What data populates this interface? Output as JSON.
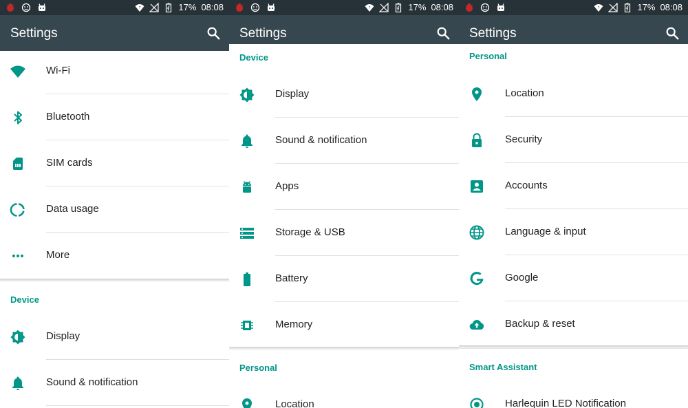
{
  "colors": {
    "accent": "#009688",
    "toolbar": "#37474f",
    "statusbar": "#263238",
    "text": "#212121"
  },
  "status": {
    "battery": "17%",
    "time": "08:08"
  },
  "toolbar": {
    "title": "Settings"
  },
  "panel1": {
    "items1": [
      {
        "label": "Wi-Fi",
        "icon": "wifi-icon"
      },
      {
        "label": "Bluetooth",
        "icon": "bluetooth-icon"
      },
      {
        "label": "SIM cards",
        "icon": "sim-card-icon"
      },
      {
        "label": "Data usage",
        "icon": "data-usage-icon"
      },
      {
        "label": "More",
        "icon": "more-icon"
      }
    ],
    "category": "Device",
    "items2": [
      {
        "label": "Display",
        "icon": "display-icon"
      },
      {
        "label": "Sound & notification",
        "icon": "bell-icon"
      }
    ]
  },
  "panel2": {
    "category1": "Device",
    "items1": [
      {
        "label": "Display",
        "icon": "display-icon"
      },
      {
        "label": "Sound & notification",
        "icon": "bell-icon"
      },
      {
        "label": "Apps",
        "icon": "android-icon"
      },
      {
        "label": "Storage & USB",
        "icon": "storage-icon"
      },
      {
        "label": "Battery",
        "icon": "battery-icon"
      },
      {
        "label": "Memory",
        "icon": "memory-icon"
      }
    ],
    "category2": "Personal",
    "items2": [
      {
        "label": "Location",
        "icon": "location-icon"
      }
    ]
  },
  "panel3": {
    "category1": "Personal",
    "items1": [
      {
        "label": "Location",
        "icon": "location-icon"
      },
      {
        "label": "Security",
        "icon": "lock-icon"
      },
      {
        "label": "Accounts",
        "icon": "account-icon"
      },
      {
        "label": "Language & input",
        "icon": "globe-icon"
      },
      {
        "label": "Google",
        "icon": "google-icon"
      },
      {
        "label": "Backup & reset",
        "icon": "cloud-upload-icon"
      }
    ],
    "category2": "Smart Assistant",
    "items2": [
      {
        "label": "Harlequin LED Notification",
        "icon": "led-icon"
      }
    ]
  }
}
